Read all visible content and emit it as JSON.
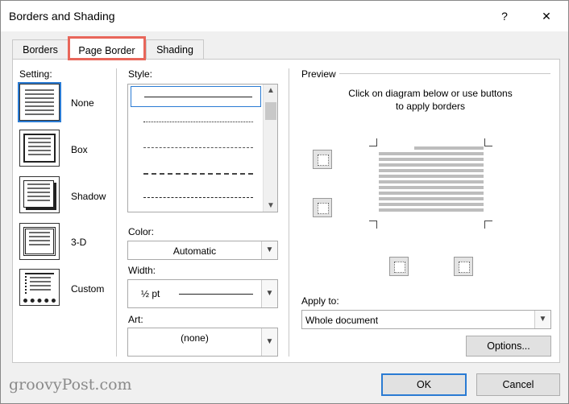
{
  "window": {
    "title": "Borders and Shading",
    "help": "?",
    "close": "✕"
  },
  "tabs": [
    {
      "label": "Borders",
      "mnemonic": "B"
    },
    {
      "label": "Page Border",
      "mnemonic": "P",
      "active": true
    },
    {
      "label": "Shading",
      "mnemonic": "S"
    }
  ],
  "setting": {
    "label": "Setting:",
    "options": [
      "None",
      "Box",
      "Shadow",
      "3-D",
      "Custom"
    ],
    "selected": "None"
  },
  "style": {
    "label": "Style:"
  },
  "color": {
    "label": "Color:",
    "value": "Automatic"
  },
  "width": {
    "label": "Width:",
    "value": "½ pt"
  },
  "art": {
    "label": "Art:",
    "value": "(none)"
  },
  "preview": {
    "label": "Preview",
    "hint_line1": "Click on diagram below or use buttons",
    "hint_line2": "to apply borders"
  },
  "apply_to": {
    "label": "Apply to:",
    "value": "Whole document"
  },
  "buttons": {
    "options": "Options...",
    "ok": "OK",
    "cancel": "Cancel"
  },
  "watermark": "groovyPost.com",
  "colors": {
    "accent": "#2a7bd3",
    "highlight": "#e8665a"
  }
}
